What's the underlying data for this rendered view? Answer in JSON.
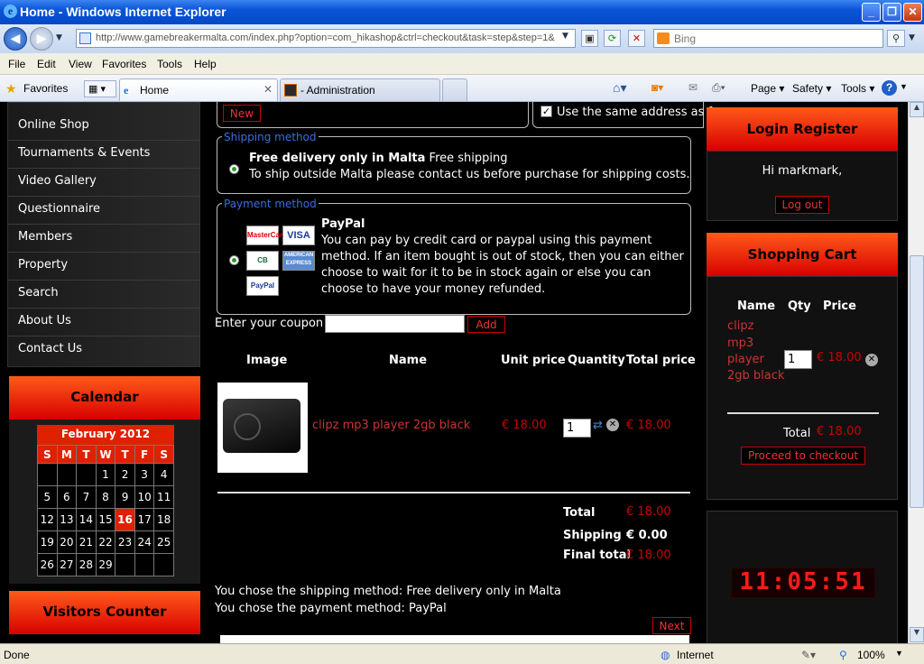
{
  "window": {
    "title": "Home - Windows Internet Explorer",
    "min": "_",
    "max": "❐",
    "close": "✕"
  },
  "address": {
    "url": "http://www.gamebreakermalta.com/index.php?option=com_hikashop&ctrl=checkout&task=step&step=1&",
    "search_placeholder": "Bing"
  },
  "menu": [
    "File",
    "Edit",
    "View",
    "Favorites",
    "Tools",
    "Help"
  ],
  "favorites_label": "Favorites",
  "tabs": [
    {
      "label": "Home"
    },
    {
      "label": "- Administration"
    }
  ],
  "cmdbar": {
    "page": "Page",
    "safety": "Safety",
    "tools": "Tools"
  },
  "status": {
    "left": "Done",
    "zone": "Internet",
    "zoom": "100%"
  },
  "sidebar": {
    "items": [
      "Online Shop",
      "Tournaments & Events",
      "Video Gallery",
      "Questionnaire",
      "Members",
      "Property",
      "Search",
      "About Us",
      "Contact Us"
    ],
    "calendar_title": "Calendar",
    "month": "February 2012",
    "weekdays": [
      "S",
      "M",
      "T",
      "W",
      "T",
      "F",
      "S"
    ],
    "weeks": [
      [
        "",
        "",
        "",
        "1",
        "2",
        "3",
        "4"
      ],
      [
        "5",
        "6",
        "7",
        "8",
        "9",
        "10",
        "11"
      ],
      [
        "12",
        "13",
        "14",
        "15",
        "16",
        "17",
        "18"
      ],
      [
        "19",
        "20",
        "21",
        "22",
        "23",
        "24",
        "25"
      ],
      [
        "26",
        "27",
        "28",
        "29",
        "",
        "",
        ""
      ]
    ],
    "today": "16",
    "visitors_title": "Visitors Counter"
  },
  "checkout": {
    "new_label": "New",
    "same_address": "Use the same address as fo",
    "shipping_legend": "Shipping method",
    "shipping_name": "Free delivery only in Malta",
    "shipping_price": "Free shipping",
    "shipping_desc": "To ship outside Malta please contact us before purchase for shipping costs.",
    "payment_legend": "Payment method",
    "payment_name": "PayPal",
    "payment_desc": [
      "You can pay by credit card or paypal using this payment",
      "method. If an item bought is out of stock, then you can either",
      "choose to wait for it to be in stock again or else you can",
      "choose to have your money refunded."
    ],
    "cards": [
      "MasterCard",
      "VISA",
      "CB",
      "AMERICAN EXPRESS",
      "PayPal"
    ],
    "coupon_label": "Enter your coupon",
    "coupon_add": "Add",
    "headers": [
      "Image",
      "Name",
      "Unit price",
      "Quantity",
      "Total price"
    ],
    "product": {
      "name": "clipz mp3 player 2gb black",
      "unit": "€ 18.00",
      "qty": "1",
      "total": "€ 18.00"
    },
    "totals": {
      "total_label": "Total",
      "total": "€ 18.00",
      "shipping_label": "Shipping",
      "shipping": "€ 0.00",
      "final_label": "Final total",
      "final": "€ 18.00"
    },
    "summary": [
      "You chose the shipping method: Free delivery only in Malta",
      "You chose the payment method: PayPal"
    ],
    "next": "Next"
  },
  "right": {
    "login_title": "Login Register",
    "greeting": "Hi markmark,",
    "logout": "Log out",
    "cart_title": "Shopping Cart",
    "cart_headers": [
      "Name",
      "Qty",
      "Price"
    ],
    "cart_item": [
      "clipz",
      "mp3",
      "player",
      "2gb black"
    ],
    "cart_qty": "1",
    "cart_price": "€ 18.00",
    "cart_total_label": "Total",
    "cart_total": "€ 18.00",
    "checkout": "Proceed to checkout",
    "clock": "11:05:51"
  }
}
